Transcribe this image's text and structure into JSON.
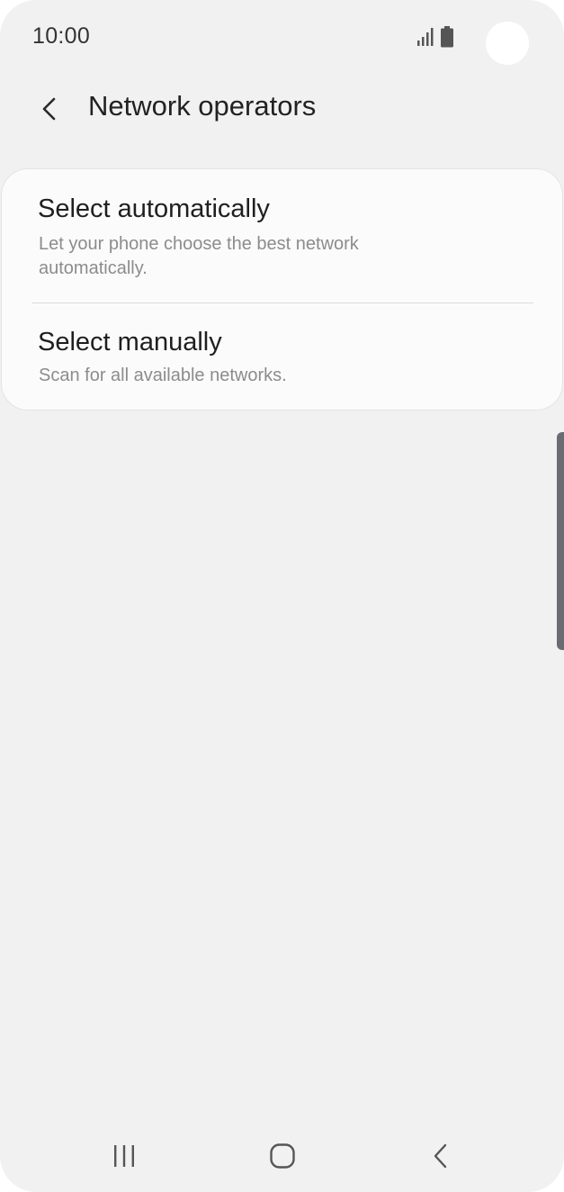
{
  "status_bar": {
    "time": "10:00",
    "icons": [
      "signal-icon",
      "battery-icon"
    ]
  },
  "header": {
    "back_icon": "chevron-left-icon",
    "title": "Network operators"
  },
  "options": [
    {
      "title": "Select automatically",
      "description": "Let your phone choose the best network automatically."
    },
    {
      "title": "Select manually",
      "description": "Scan for all available networks."
    }
  ],
  "nav_bar": {
    "icons": [
      "recent-apps-icon",
      "home-icon",
      "back-icon"
    ]
  },
  "colors": {
    "background": "#f1f1f1",
    "card": "#fbfbfb",
    "primary_text": "#1f1f1f",
    "secondary_text": "#8c8c8c",
    "scroll_indicator": "#6b6b73"
  }
}
